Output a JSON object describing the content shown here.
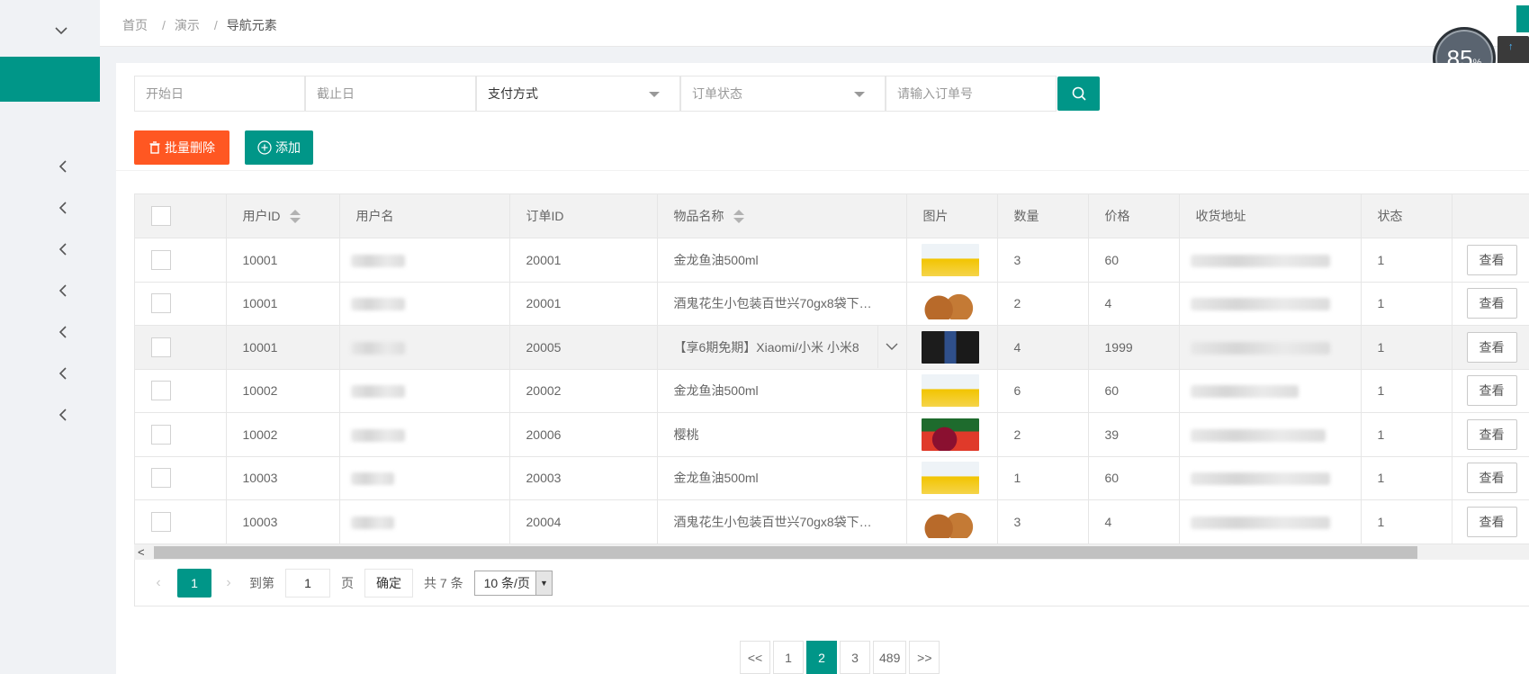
{
  "breadcrumb": [
    "首页",
    "演示",
    "导航元素"
  ],
  "speed_widget": {
    "value": "85",
    "unit": "%",
    "up": "↑",
    "down": "↓"
  },
  "search": {
    "start_date_placeholder": "开始日",
    "end_date_placeholder": "截止日",
    "payment_select": "支付方式",
    "order_status_select": "订单状态",
    "order_no_placeholder": "请输入订单号"
  },
  "toolbar": {
    "batch_delete": "批量删除",
    "add": "添加"
  },
  "table": {
    "headers": [
      "用户ID",
      "用户名",
      "订单ID",
      "物品名称",
      "图片",
      "数量",
      "价格",
      "收货地址",
      "状态"
    ],
    "rows": [
      {
        "uid": "10001",
        "order_id": "20001",
        "item": "金龙鱼油500ml",
        "img": "oil",
        "qty": "3",
        "price": "60",
        "status": "1",
        "action": "查看"
      },
      {
        "uid": "10001",
        "order_id": "20001",
        "item": "酒鬼花生小包装百世兴70gx8袋下…",
        "img": "nut",
        "qty": "2",
        "price": "4",
        "status": "1",
        "action": "查看"
      },
      {
        "uid": "10001",
        "order_id": "20005",
        "item": "【享6期免期】Xiaomi/小米 小米8",
        "img": "phone",
        "qty": "4",
        "price": "1999",
        "status": "1",
        "action": "查看"
      },
      {
        "uid": "10002",
        "order_id": "20002",
        "item": "金龙鱼油500ml",
        "img": "oil",
        "qty": "6",
        "price": "60",
        "status": "1",
        "action": "查看"
      },
      {
        "uid": "10002",
        "order_id": "20006",
        "item": "樱桃",
        "img": "cherry",
        "qty": "2",
        "price": "39",
        "status": "1",
        "action": "查看"
      },
      {
        "uid": "10003",
        "order_id": "20003",
        "item": "金龙鱼油500ml",
        "img": "oil",
        "qty": "1",
        "price": "60",
        "status": "1",
        "action": "查看"
      },
      {
        "uid": "10003",
        "order_id": "20004",
        "item": "酒鬼花生小包装百世兴70gx8袋下…",
        "img": "nut",
        "qty": "3",
        "price": "4",
        "status": "1",
        "action": "查看"
      }
    ]
  },
  "pager": {
    "current": "1",
    "goto_label": "到第",
    "goto_value": "1",
    "page_label": "页",
    "confirm": "确定",
    "total": "共 7 条",
    "page_size": "10 条/页"
  },
  "pager2": [
    "<<",
    "1",
    "2",
    "3",
    "489",
    ">>"
  ],
  "pager2_active": "2",
  "colors": {
    "primary": "#009688",
    "danger": "#ff5722"
  }
}
